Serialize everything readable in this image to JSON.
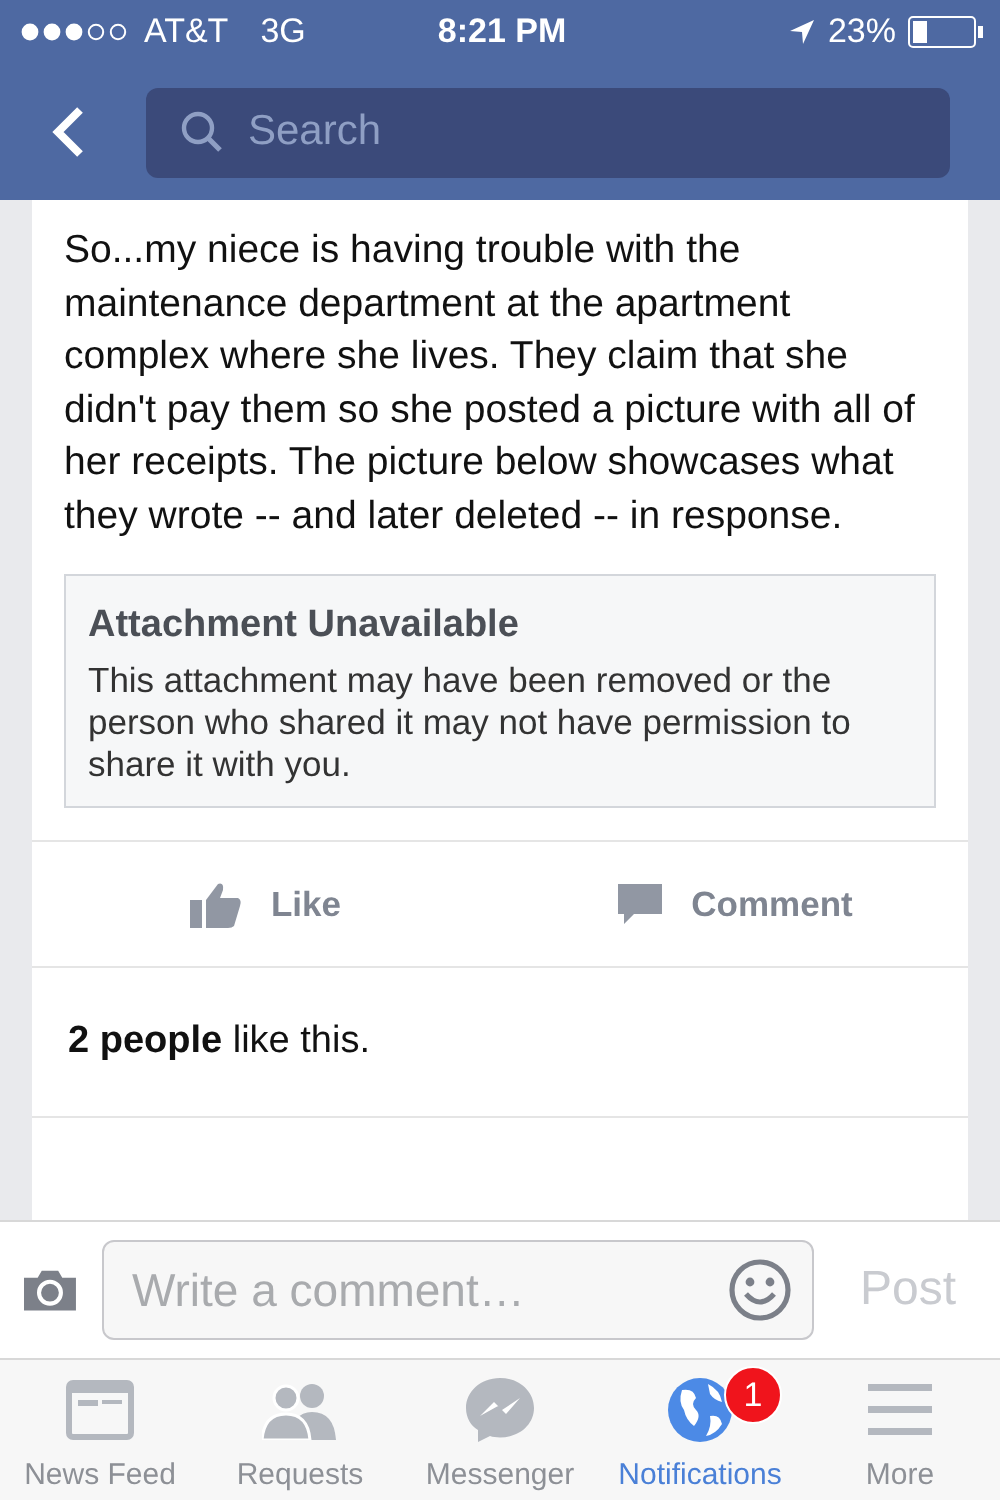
{
  "status_bar": {
    "carrier": "AT&T",
    "network": "3G",
    "time": "8:21 PM",
    "battery": "23%"
  },
  "nav": {
    "search": {
      "placeholder": "Search"
    }
  },
  "post": {
    "text": "So...my niece is having trouble with the maintenance department at the apartment complex where she lives. They claim that she didn't pay them so she posted a picture with all of her receipts. The picture below showcases what they wrote -- and later deleted -- in response.",
    "attachment": {
      "title": "Attachment Unavailable",
      "message": "This attachment may have been removed or the person who shared it may not have permission to share it with you."
    },
    "actions": [
      {
        "kind": "like",
        "label": "Like"
      },
      {
        "kind": "comment",
        "label": "Comment"
      }
    ],
    "likes": "**2 people** like this."
  },
  "comment_bar": {
    "placeholder": "Write a comment…",
    "post": "Post"
  },
  "tabs": [
    {
      "kind": "feed",
      "label": "News Feed",
      "selected": false
    },
    {
      "kind": "requests",
      "label": "Requests",
      "selected": false
    },
    {
      "kind": "messenger",
      "label": "Messenger",
      "selected": false
    },
    {
      "kind": "notifications",
      "label": "Notifications",
      "selected": true,
      "badge": "1"
    },
    {
      "kind": "more",
      "label": "More",
      "selected": false
    }
  ]
}
